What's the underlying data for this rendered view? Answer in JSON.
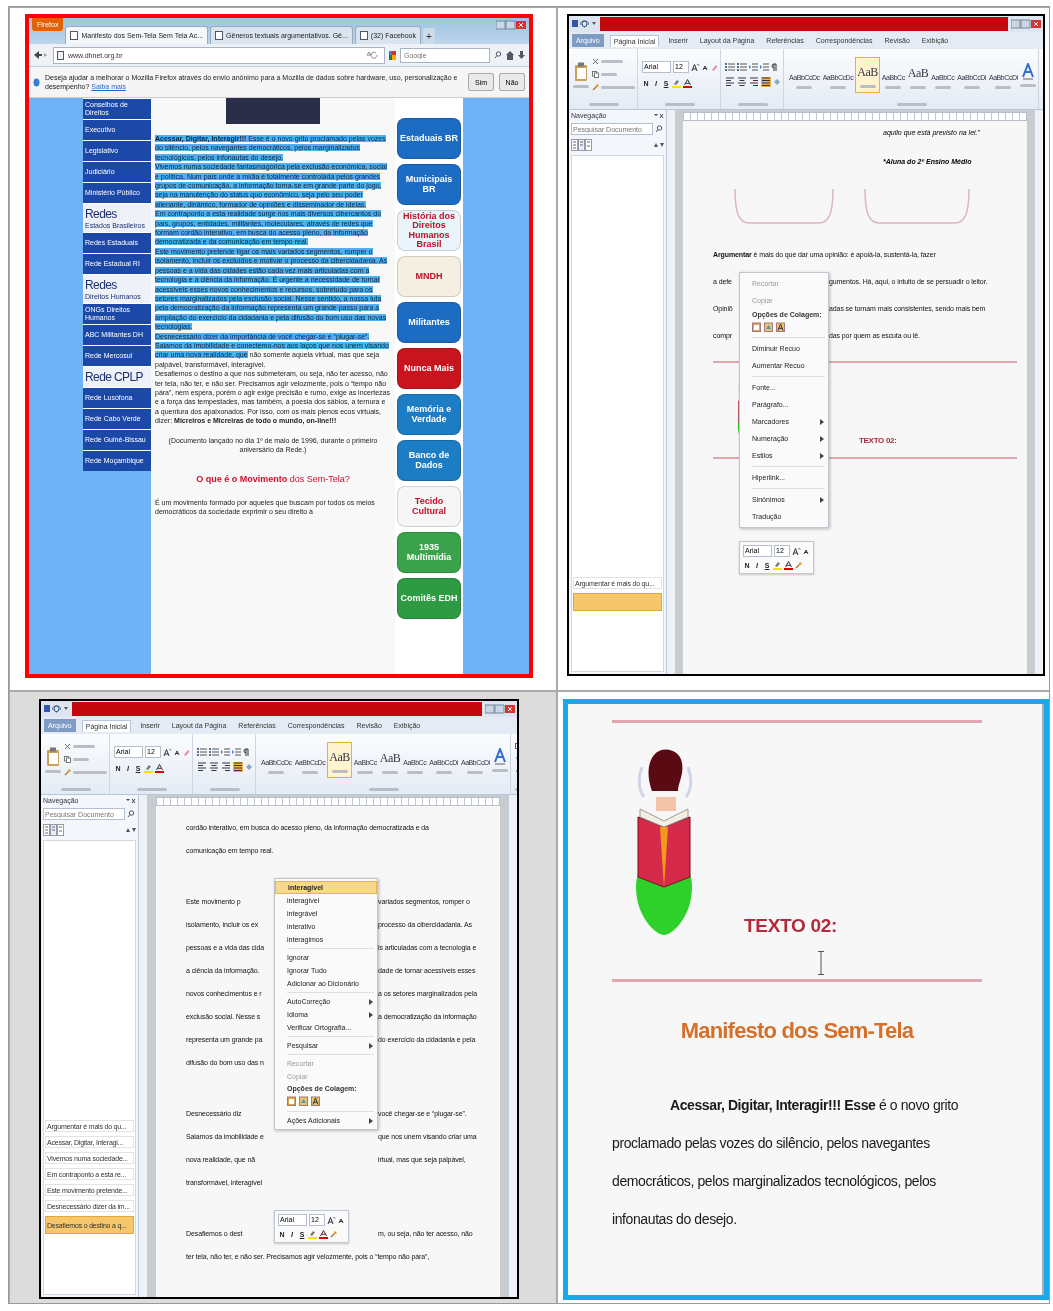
{
  "panels": [
    {
      "kind": "browser",
      "color": "#ff0000",
      "menu_button": "Firefox",
      "tabs": [
        {
          "label": "Manifesto dos Sem-Tela Sem Tela Ac...",
          "selected": true
        },
        {
          "label": "Gêneros textuais argumentativos. Gê...",
          "selected": false
        },
        {
          "label": "(32) Facebook",
          "selected": false
        }
      ],
      "new_tab": "+",
      "address": "www.dhnet.org.br",
      "search_placeholder": "Google",
      "notification": {
        "text": "Deseja ajudar a melhorar o Mozilla Firefox através do envio anônimo para a Mozilla de dados sobre hardware, uso, personalização e desempenho?",
        "link": "Saiba mais",
        "buttons": [
          "Sim",
          "Não"
        ]
      },
      "sidebar": [
        {
          "kind": "link",
          "label": "Conselhos de Direitos"
        },
        {
          "kind": "link",
          "label": "Executivo"
        },
        {
          "kind": "link",
          "label": "Legislativo"
        },
        {
          "kind": "link",
          "label": "Judiciário"
        },
        {
          "kind": "link",
          "label": "Ministério Público"
        },
        {
          "kind": "heading",
          "label": "Redes",
          "sub": "Estados Brasileiros"
        },
        {
          "kind": "link",
          "label": "Redes Estaduais"
        },
        {
          "kind": "link",
          "label": "Rede Estadual RI"
        },
        {
          "kind": "heading",
          "label": "Redes",
          "sub": "Direitos Humanos"
        },
        {
          "kind": "link",
          "label": "ONGs Direitos Humanos"
        },
        {
          "kind": "link",
          "label": "ABC Militantes DH"
        },
        {
          "kind": "link",
          "label": "Rede Mercosul"
        },
        {
          "kind": "heading",
          "label": "Rede CPLP"
        },
        {
          "kind": "link",
          "label": "Rede Lusófona"
        },
        {
          "kind": "link",
          "label": "Rede Cabo Verde"
        },
        {
          "kind": "link",
          "label": "Rede Guiné-Bissau"
        },
        {
          "kind": "link",
          "label": "Rede Moçambique"
        }
      ],
      "article": [
        {
          "kind": "text",
          "segments": [
            {
              "text": "**Acessar, Digitar, Interagir!!!** Esse é o novo grito proclamado pelas vozes do silêncio, pelos navegantes democráticos, pelos marginalizados tecnológicos, pelos infonautas do desejo.",
              "selected": true
            }
          ]
        },
        {
          "kind": "text",
          "segments": [
            {
              "text": "Vivemos numa sociedade fantasmagórica pela exclusão econômica, social e política. Num país onde a mídia é totalmente controlada pelos grandes grupos de comunicação, a informação torna-se em grande parte do jogo, seja na manutenção do status quo econômico, seja pelo seu poder alienante, dinâmico, formador de opiniões e disseminador de ideias.",
              "selected": true
            }
          ]
        },
        {
          "kind": "text",
          "segments": [
            {
              "text": "Em contraponto a esta realidade surge nos mais diversos cibercantos do país, grupos, entidades, militantes, moleculares, através de redes que formam cordão interativo, em busca do acesso pleno, da informação democratizada e da comunicação em tempo real.",
              "selected": true
            }
          ]
        },
        {
          "kind": "text",
          "segments": [
            {
              "text": "Este movimento pretende ligar os mais variados segmentos, romper o isolamento, incluir os excluídos e motivar o processo da cibercidadania. As pessoas e a vida das cidades estão cada vez mais articuladas com a tecnologia e a ciência da informação. É urgente a necessidade de tornar acessíveis esses novos conhecimentos e recursos, sobretudo para os setores marginalizados pela exclusão social. Nesse sentido, a nossa luta pela democratização da informação representa um grande passo para a ampliação do exercício da cidadania e pela difusão do bom uso das novas tecnologias.",
              "selected": true
            }
          ]
        },
        {
          "kind": "text",
          "segments": [
            {
              "text": "Desnecessário dizer da importância de você chegar-se e “plugar-se”. Saiamos da imobilidade e conectemo-nos aos laços que nos unem visando criar uma nova realidade, que",
              "selected": true
            },
            {
              "text": " não somente aquela virtual, mas que seja palpável, transformável, interagível.",
              "selected": false
            }
          ]
        },
        {
          "kind": "text",
          "segments": [
            {
              "text": "Desafiemos o destino a que nos submeteram, ou seja, não ter acesso, não ter tela, não ter, e não ser. Precisamos agir velozmente, pois o “tempo não pára”, nem espera, porém o agir exige precisão e rumo, exige as incertezas e a força das tempestades, mas também, a poesia dos sábios, a ternura e a quentura dos apaixonados. Por isso, com os mais plenos ecos virtuais, dizer: **Micreiros e Micreiras de todo o mundo, on-line!!!**",
              "selected": false
            }
          ]
        },
        {
          "kind": "note",
          "segments": [
            {
              "text": "(Documento lançado no dia 1º de maio de 1996, durante o primeiro aniversário da Rede.)",
              "selected": false
            }
          ]
        },
        {
          "kind": "title",
          "segments": [
            {
              "text": "**O que é o Movimento** dos Sem-Tela?",
              "selected": false
            }
          ]
        },
        {
          "kind": "text",
          "segments": [
            {
              "text": "É um movimento formado por aqueles que buscam por todos os meios democráticos da sociedade exprimir o seu direito à",
              "selected": false
            }
          ]
        }
      ],
      "banners": [
        {
          "label": "Estaduais BR",
          "color": "#1c6cc4"
        },
        {
          "label": "Municipais BR",
          "color": "#1c6cc4"
        },
        {
          "label": "História dos Direitos Humanos Brasil",
          "color": "#eaf4fb"
        },
        {
          "label": "MNDH",
          "color": "#f4efe0"
        },
        {
          "label": "Militantes",
          "color": "#1c6cc4"
        },
        {
          "label": "Nunca Mais",
          "color": "#c8141e"
        },
        {
          "label": "Memória e Verdade",
          "color": "#1c7cc4"
        },
        {
          "label": "Banco de Dados",
          "color": "#1c7cc4"
        },
        {
          "label": "Tecido Cultural",
          "color": "#f6f6f6"
        },
        {
          "label": "1935 Multimídia",
          "color": "#3aa24a"
        },
        {
          "label": "Comitês EDH",
          "color": "#2e9a44"
        }
      ]
    },
    {
      "kind": "word",
      "color": "#000000",
      "ribbon_tabs": [
        {
          "label": "Arquivo",
          "kind": "file",
          "selected": false
        },
        {
          "label": "Página Inicial",
          "kind": "tab",
          "selected": true
        },
        {
          "label": "Inserir",
          "kind": "tab",
          "selected": false
        },
        {
          "label": "Layout da Página",
          "kind": "tab",
          "selected": false
        },
        {
          "label": "Referências",
          "kind": "tab",
          "selected": false
        },
        {
          "label": "Correspondências",
          "kind": "tab",
          "selected": false
        },
        {
          "label": "Revisão",
          "kind": "tab",
          "selected": false
        },
        {
          "label": "Exibição",
          "kind": "tab",
          "selected": false
        }
      ],
      "font": {
        "name": "Arial",
        "size": "12",
        "format_buttons": [
          "N",
          "I",
          "S"
        ]
      },
      "paragraph_alignment": [
        {
          "selected": false
        },
        {
          "selected": false
        },
        {
          "selected": false
        },
        {
          "selected": true
        }
      ],
      "styles": [
        {
          "preview": "AaBbCcDc",
          "selected": false
        },
        {
          "preview": "AaBbCcDc",
          "selected": false
        },
        {
          "preview": "AaB",
          "selected": true
        },
        {
          "preview": "AaBbCc",
          "selected": false
        },
        {
          "preview": "AaB",
          "selected": false
        },
        {
          "preview": "AaBbCc",
          "selected": false
        },
        {
          "preview": "AaBbCcDi",
          "selected": false
        },
        {
          "preview": "AaBbCcDi",
          "selected": false
        }
      ],
      "nav": {
        "title": "Navegação",
        "search_placeholder": "Pesquisar Documento",
        "headings": [
          {
            "label": "Argumentar é mais do qu...",
            "selected": false
          },
          {
            "selected": true
          }
        ]
      },
      "blocks": [
        {
          "kind": "quote",
          "text": "aquilo que está previsto na lei.”"
        },
        {
          "kind": "signature",
          "text": "*Aluna do 2º Ensino Médio"
        },
        {
          "kind": "brackets"
        },
        {
          "kind": "paragraph",
          "lines": [
            [
              "**Argumentar** é mais do que dar uma opinião: é apoiá-la, sustentá-la, fazer"
            ],
            [
              "a defe",
              "gumentos. Há, aqui, o intuito de se persuadir o leitor."
            ],
            [
              "Opiniõ",
              "adas se tornam mais consistentes, sendo mais bem"
            ],
            [
              "compr",
              "das por quem as escuta ou lê."
            ]
          ]
        },
        {
          "kind": "rule"
        },
        {
          "kind": "heading_art",
          "text": "TEXTO 02:"
        },
        {
          "kind": "rule"
        }
      ],
      "context_menu": [
        {
          "kind": "item",
          "label": "Recortar",
          "disabled": true,
          "selected": false,
          "submenu": false
        },
        {
          "kind": "item",
          "label": "Copiar",
          "disabled": true,
          "selected": false,
          "submenu": false
        },
        {
          "kind": "label",
          "label": "Opções de Colagem:"
        },
        {
          "kind": "paste"
        },
        {
          "kind": "separator"
        },
        {
          "kind": "item",
          "label": "Diminuir Recuo",
          "disabled": false,
          "selected": false,
          "submenu": false
        },
        {
          "kind": "item",
          "label": "Aumentar Recuo",
          "disabled": false,
          "selected": false,
          "submenu": false
        },
        {
          "kind": "separator"
        },
        {
          "kind": "item",
          "label": "Fonte...",
          "disabled": false,
          "selected": false,
          "submenu": false
        },
        {
          "kind": "item",
          "label": "Parágrafo...",
          "disabled": false,
          "selected": false,
          "submenu": false
        },
        {
          "kind": "item",
          "label": "Marcadores",
          "disabled": false,
          "selected": false,
          "submenu": true
        },
        {
          "kind": "item",
          "label": "Numeração",
          "disabled": false,
          "selected": false,
          "submenu": true
        },
        {
          "kind": "item",
          "label": "Estilos",
          "disabled": false,
          "selected": false,
          "submenu": true
        },
        {
          "kind": "separator"
        },
        {
          "kind": "item",
          "label": "Hiperlink...",
          "disabled": false,
          "selected": false,
          "submenu": false
        },
        {
          "kind": "separator"
        },
        {
          "kind": "item",
          "label": "Sinônimos",
          "disabled": false,
          "selected": false,
          "submenu": true
        },
        {
          "kind": "item",
          "label": "Tradução",
          "disabled": false,
          "selected": false,
          "submenu": false
        }
      ],
      "mini_toolbar": {
        "font": "Arial",
        "size": "12",
        "format_buttons": [
          "N",
          "I",
          "S"
        ]
      }
    },
    {
      "kind": "word",
      "color": "#000000",
      "ribbon_tabs": [
        {
          "label": "Arquivo",
          "kind": "file",
          "selected": false
        },
        {
          "label": "Página Inicial",
          "kind": "tab",
          "selected": true
        },
        {
          "label": "Inserir",
          "kind": "tab",
          "selected": false
        },
        {
          "label": "Layout da Página",
          "kind": "tab",
          "selected": false
        },
        {
          "label": "Referências",
          "kind": "tab",
          "selected": false
        },
        {
          "label": "Correspondências",
          "kind": "tab",
          "selected": false
        },
        {
          "label": "Revisão",
          "kind": "tab",
          "selected": false
        },
        {
          "label": "Exibição",
          "kind": "tab",
          "selected": false
        }
      ],
      "font": {
        "name": "Arial",
        "size": "12",
        "format_buttons": [
          "N",
          "I",
          "S"
        ]
      },
      "paragraph_alignment": [
        {
          "selected": false
        },
        {
          "selected": false
        },
        {
          "selected": false
        },
        {
          "selected": true
        }
      ],
      "styles": [
        {
          "preview": "AaBbCcDc",
          "selected": false
        },
        {
          "preview": "AaBbCcDc",
          "selected": false
        },
        {
          "preview": "AaB",
          "selected": true
        },
        {
          "preview": "AaBbCc",
          "selected": false
        },
        {
          "preview": "AaB",
          "selected": false
        },
        {
          "preview": "AaBbCc",
          "selected": false
        },
        {
          "preview": "AaBbCcDi",
          "selected": false
        },
        {
          "preview": "AaBbCcDi",
          "selected": false
        }
      ],
      "nav": {
        "title": "Navegação",
        "search_placeholder": "Pesquisar Documento",
        "headings": [
          {
            "label": "Argumentar é mais do qu...",
            "selected": false
          },
          {
            "label": "Acessar, Digitar, Interagi...",
            "selected": false
          },
          {
            "label": "Vivemos numa sociedade...",
            "selected": false
          },
          {
            "label": "Em contraponto a esta re...",
            "selected": false
          },
          {
            "label": "Este movimento pretende...",
            "selected": false
          },
          {
            "label": "Desnecessário dizer da im...",
            "selected": false
          },
          {
            "label": "Desafiemos o destino a q...",
            "selected": true
          }
        ]
      },
      "blocks": [
        {
          "kind": "paragraph",
          "lines": [
            [
              "cordão interativo, em busca do acesso pleno, da informação democratizada e da"
            ],
            [
              "comunicação em tempo real."
            ]
          ]
        },
        {
          "kind": "paragraph",
          "lines": [
            [
              "Este movimento p",
              "variados segmentos, romper o"
            ],
            [
              "isolamento, incluir os ex",
              "processo da cibercidadania. As"
            ],
            [
              "pessoas e a vida das cida",
              "is articuladas com a tecnologia e"
            ],
            [
              "a ciência da informação.",
              "dade de tornar acessíveis esses"
            ],
            [
              "novos conhecimentos e r",
              "a os setores marginalizados pela"
            ],
            [
              "exclusão social. Nesse s",
              "a democratização da informação"
            ],
            [
              "representa um grande pa",
              "do exercício da cidadania e pela"
            ],
            [
              "difusão do bom uso das n"
            ]
          ]
        },
        {
          "kind": "paragraph",
          "lines": [
            [
              "Desnecessário diz",
              "você chegar-se e “plugar-se”."
            ],
            [
              "Saiamos da imobilidade e",
              "que nos unem visando criar uma"
            ],
            [
              "nova realidade, que nã",
              "irtual, mas que seja palpável,"
            ],
            [
              "transformável, interagível"
            ]
          ]
        },
        {
          "kind": "paragraph",
          "lines": [
            [
              "Desafiemos o dest",
              "m, ou seja, não ter acesso, não"
            ],
            [
              "ter tela, não ter, e não ser. Precisamos agir velozmente, pois o “tempo não pára”,"
            ]
          ]
        }
      ],
      "context_menu": [
        {
          "kind": "item",
          "label": "interagível",
          "disabled": false,
          "selected": true,
          "submenu": false
        },
        {
          "kind": "item",
          "label": "interagível",
          "disabled": false,
          "selected": false,
          "submenu": false
        },
        {
          "kind": "item",
          "label": "integrável",
          "disabled": false,
          "selected": false,
          "submenu": false
        },
        {
          "kind": "item",
          "label": "interativo",
          "disabled": false,
          "selected": false,
          "submenu": false
        },
        {
          "kind": "item",
          "label": "interagimos",
          "disabled": false,
          "selected": false,
          "submenu": false
        },
        {
          "kind": "separator"
        },
        {
          "kind": "item",
          "label": "Ignorar",
          "disabled": false,
          "selected": false,
          "submenu": false
        },
        {
          "kind": "item",
          "label": "Ignorar Tudo",
          "disabled": false,
          "selected": false,
          "submenu": false
        },
        {
          "kind": "item",
          "label": "Adicionar ao Dicionário",
          "disabled": false,
          "selected": false,
          "submenu": false
        },
        {
          "kind": "separator"
        },
        {
          "kind": "item",
          "label": "AutoCorreção",
          "disabled": false,
          "selected": false,
          "submenu": true
        },
        {
          "kind": "item",
          "label": "Idioma",
          "disabled": false,
          "selected": false,
          "submenu": true
        },
        {
          "kind": "item",
          "label": "Verificar Ortografia...",
          "disabled": false,
          "selected": false,
          "submenu": false
        },
        {
          "kind": "separator"
        },
        {
          "kind": "item",
          "label": "Pesquisar",
          "disabled": false,
          "selected": false,
          "submenu": true
        },
        {
          "kind": "separator"
        },
        {
          "kind": "item",
          "label": "Recortar",
          "disabled": true,
          "selected": false,
          "submenu": false
        },
        {
          "kind": "item",
          "label": "Copiar",
          "disabled": true,
          "selected": false,
          "submenu": false
        },
        {
          "kind": "label",
          "label": "Opções de Colagem:"
        },
        {
          "kind": "paste"
        },
        {
          "kind": "separator"
        },
        {
          "kind": "item",
          "label": "Ações Adicionais",
          "disabled": false,
          "selected": false,
          "submenu": true
        }
      ],
      "mini_toolbar": {
        "font": "Arial",
        "size": "12",
        "format_buttons": [
          "N",
          "I",
          "S"
        ]
      }
    },
    {
      "kind": "document",
      "color": "#1aa9e8",
      "blocks": [
        {
          "kind": "rule"
        },
        {
          "kind": "heading_art",
          "text": "TEXTO 02:"
        },
        {
          "kind": "pointer"
        },
        {
          "kind": "rule"
        },
        {
          "kind": "title",
          "text": "Manifesto dos Sem-Tela"
        },
        {
          "kind": "body",
          "text": "**Acessar, Digitar, Interagir!!! Esse** é o novo grito proclamado pelas vozes do silêncio, pelos navegantes democráticos, pelos marginalizados tecnológicos, pelos infonautas do desejo."
        }
      ]
    }
  ]
}
